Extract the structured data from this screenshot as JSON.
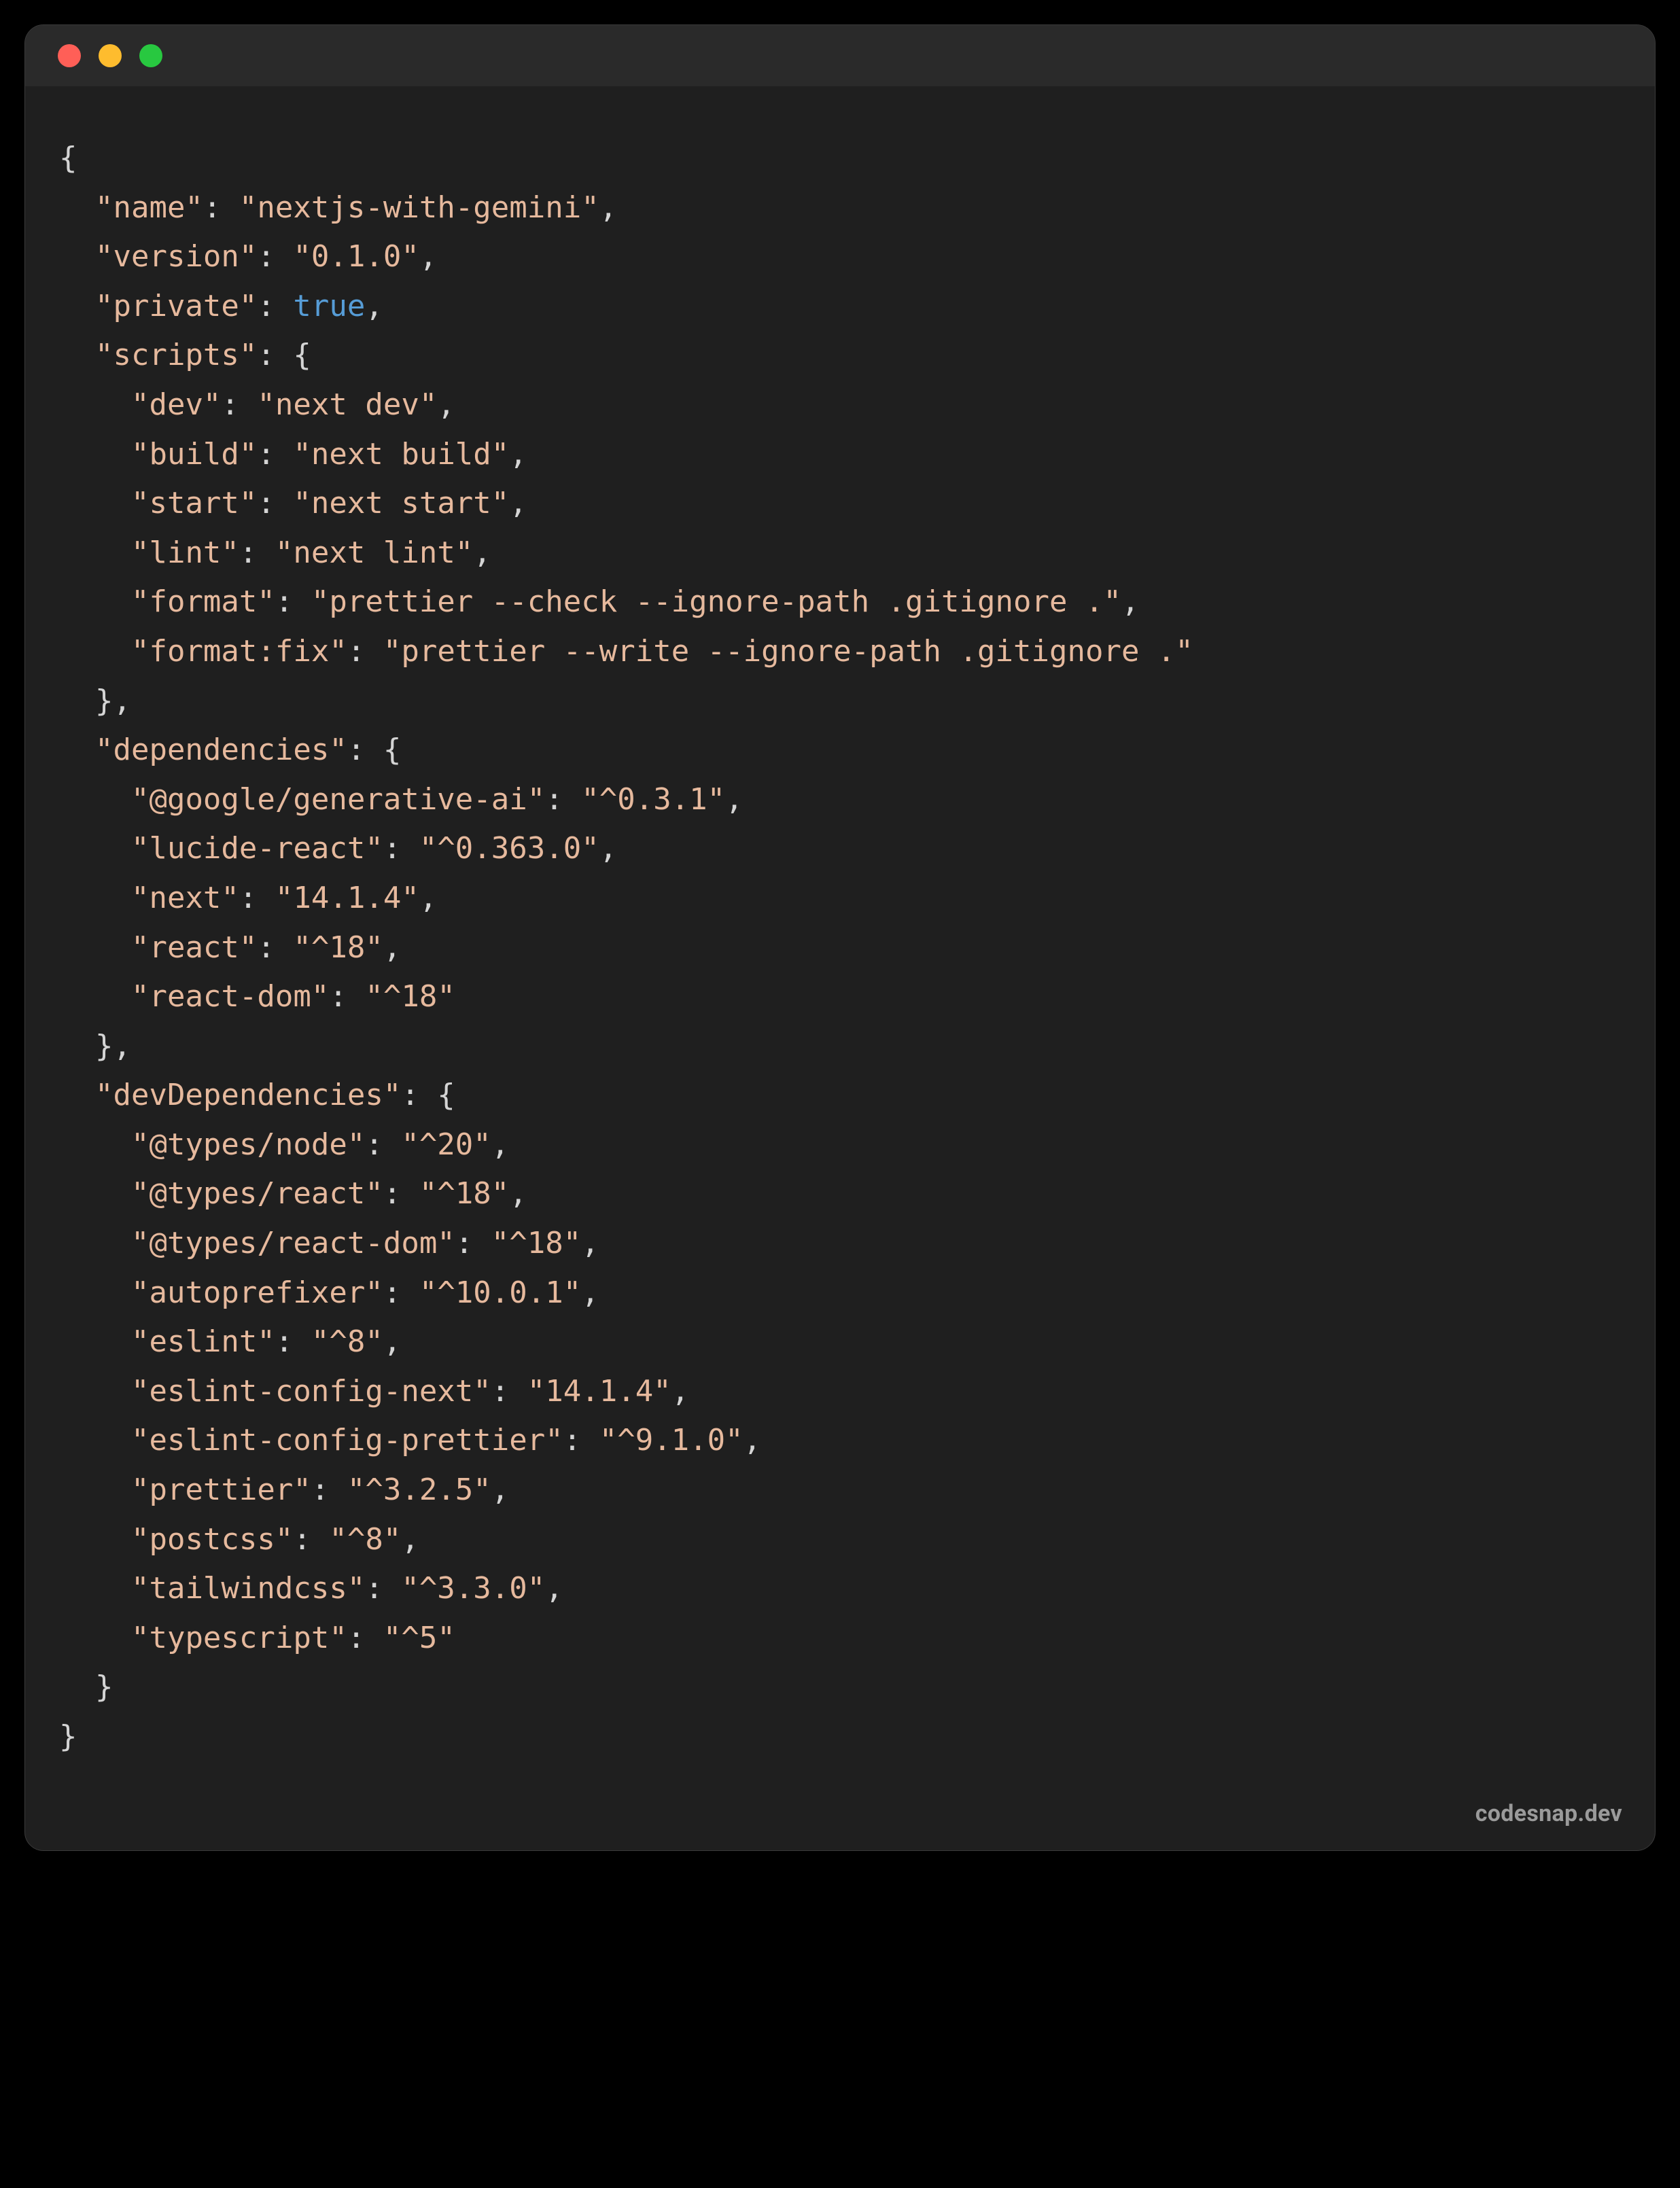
{
  "watermark": "codesnap.dev",
  "traffic_lights": {
    "red": "#ff5f57",
    "yellow": "#febc2e",
    "green": "#28c840"
  },
  "pkg": {
    "name_key": "\"name\"",
    "name_val": "\"nextjs-with-gemini\"",
    "version_key": "\"version\"",
    "version_val": "\"0.1.0\"",
    "private_key": "\"private\"",
    "private_val": "true",
    "scripts_key": "\"scripts\"",
    "scripts": {
      "dev_k": "\"dev\"",
      "dev_v": "\"next dev\"",
      "build_k": "\"build\"",
      "build_v": "\"next build\"",
      "start_k": "\"start\"",
      "start_v": "\"next start\"",
      "lint_k": "\"lint\"",
      "lint_v": "\"next lint\"",
      "format_k": "\"format\"",
      "format_v": "\"prettier --check --ignore-path .gitignore .\"",
      "formatfix_k": "\"format:fix\"",
      "formatfix_v": "\"prettier --write --ignore-path .gitignore .\""
    },
    "deps_key": "\"dependencies\"",
    "deps": {
      "gga_k": "\"@google/generative-ai\"",
      "gga_v": "\"^0.3.1\"",
      "lucide_k": "\"lucide-react\"",
      "lucide_v": "\"^0.363.0\"",
      "next_k": "\"next\"",
      "next_v": "\"14.1.4\"",
      "react_k": "\"react\"",
      "react_v": "\"^18\"",
      "reactdom_k": "\"react-dom\"",
      "reactdom_v": "\"^18\""
    },
    "devdeps_key": "\"devDependencies\"",
    "devdeps": {
      "tnode_k": "\"@types/node\"",
      "tnode_v": "\"^20\"",
      "treact_k": "\"@types/react\"",
      "treact_v": "\"^18\"",
      "treactdom_k": "\"@types/react-dom\"",
      "treactdom_v": "\"^18\"",
      "autoprefixer_k": "\"autoprefixer\"",
      "autoprefixer_v": "\"^10.0.1\"",
      "eslint_k": "\"eslint\"",
      "eslint_v": "\"^8\"",
      "eslintnext_k": "\"eslint-config-next\"",
      "eslintnext_v": "\"14.1.4\"",
      "eslintprettier_k": "\"eslint-config-prettier\"",
      "eslintprettier_v": "\"^9.1.0\"",
      "prettier_k": "\"prettier\"",
      "prettier_v": "\"^3.2.5\"",
      "postcss_k": "\"postcss\"",
      "postcss_v": "\"^8\"",
      "tailwind_k": "\"tailwindcss\"",
      "tailwind_v": "\"^3.3.0\"",
      "typescript_k": "\"typescript\"",
      "typescript_v": "\"^5\""
    }
  }
}
